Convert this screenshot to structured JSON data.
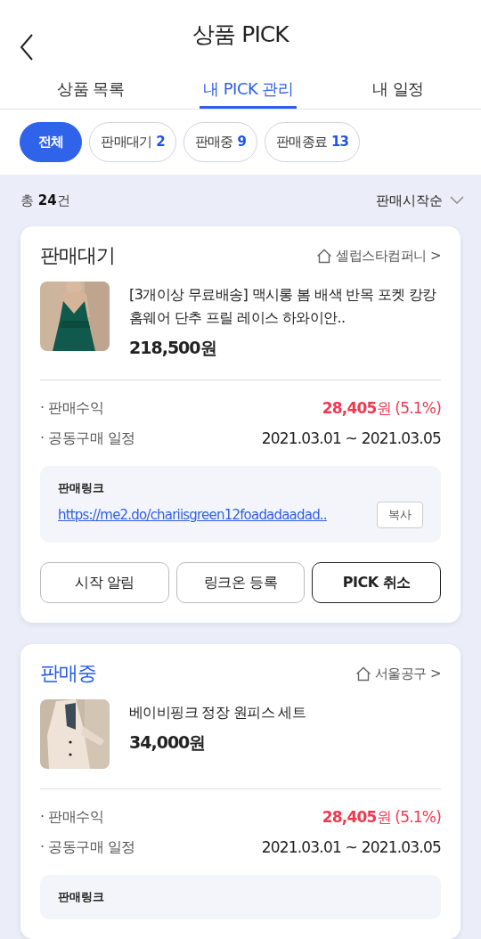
{
  "header": {
    "title": "상품 PICK"
  },
  "tabs": [
    {
      "label": "상품 목록",
      "selected": false
    },
    {
      "label": "내 PICK 관리",
      "selected": true
    },
    {
      "label": "내 일정",
      "selected": false
    }
  ],
  "filters": [
    {
      "label": "전체",
      "selected": true
    },
    {
      "label": "판매대기",
      "count": "2",
      "selected": false
    },
    {
      "label": "판매중",
      "count": "9",
      "selected": false
    },
    {
      "label": "판매종료",
      "count": "13",
      "selected": false
    }
  ],
  "summary": {
    "total": "총 **24**건",
    "sort": "판매시작순"
  },
  "cards": [
    {
      "status": "판매대기",
      "kind": "waiting",
      "seller": "셀럽스타컴퍼니 >",
      "name": "[3개이상 무료배송] 맥시롱 봄 배색 반목 포켓 캉캉 홈웨어 단추 프릴 레이스 하와이안..",
      "price": "218,500원",
      "info": [
        {
          "label": "· 판매수익",
          "value": "**28,405**원 (5.1%)",
          "kind": "profit"
        },
        {
          "label": "· 공동구매 일정",
          "value": "2021.03.01 ~ 2021.03.05",
          "kind": "date"
        }
      ],
      "link": {
        "label": "판매링크",
        "url": "https://me2.do/chariisgreen12foadadaadad..",
        "copy": "복사"
      },
      "buttons": [
        {
          "label": "시작 알림",
          "kind": "normal"
        },
        {
          "label": "링크온 등록",
          "kind": "normal"
        },
        {
          "label": "PICK 취소",
          "kind": "strong"
        }
      ]
    },
    {
      "status": "판매중",
      "kind": "selling",
      "seller": "서울공구 >",
      "name": "베이비핑크 정장 원피스 세트",
      "price": "34,000원",
      "info": [
        {
          "label": "· 판매수익",
          "value": "**28,405**원 (5.1%)",
          "kind": "profit"
        },
        {
          "label": "· 공동구매 일정",
          "value": "2021.03.01 ~ 2021.03.05",
          "kind": "date"
        }
      ],
      "link": {
        "label": "판매링크"
      }
    }
  ]
}
